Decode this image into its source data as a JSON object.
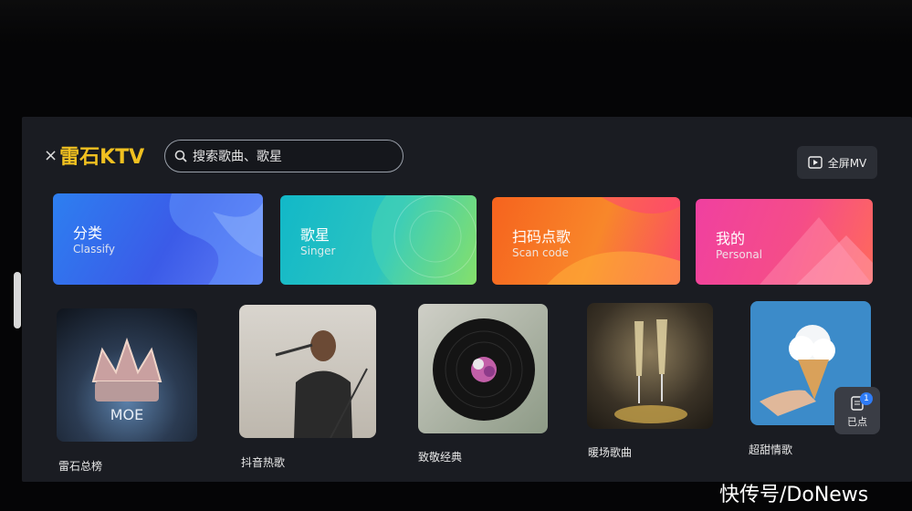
{
  "app": {
    "logo_text_prefix": "×",
    "logo_text": "雷石KTV"
  },
  "search": {
    "placeholder": "搜索歌曲、歌星"
  },
  "header": {
    "fullscreen_mv_label": "全屏MV"
  },
  "categories": [
    {
      "title": "分类",
      "subtitle": "Classify"
    },
    {
      "title": "歌星",
      "subtitle": "Singer"
    },
    {
      "title": "扫码点歌",
      "subtitle": "Scan code"
    },
    {
      "title": "我的",
      "subtitle": "Personal"
    }
  ],
  "playlists": [
    {
      "label": "雷石总榜"
    },
    {
      "label": "抖音热歌"
    },
    {
      "label": "致敬经典"
    },
    {
      "label": "暖场歌曲"
    },
    {
      "label": "超甜情歌"
    }
  ],
  "selected": {
    "label": "已点",
    "count": "1"
  },
  "watermark": "快传号/DoNews"
}
